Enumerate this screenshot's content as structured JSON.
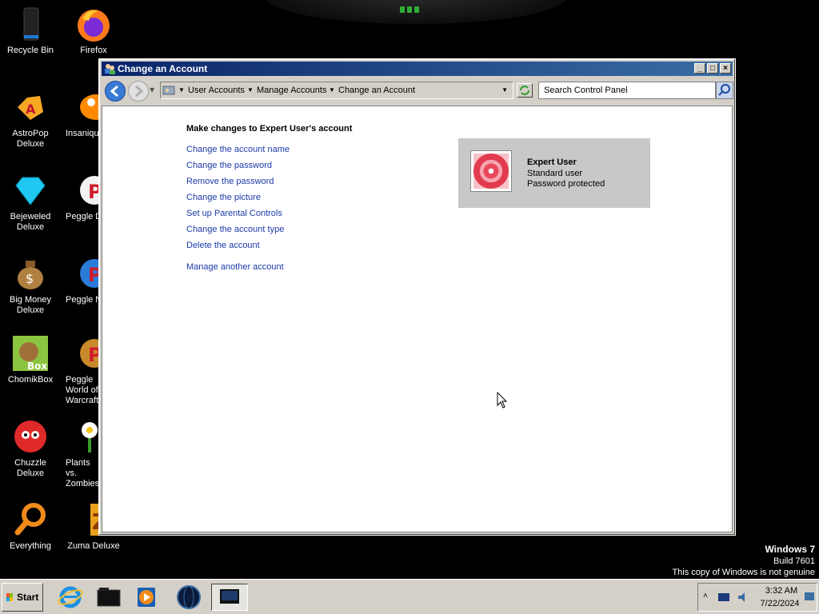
{
  "desktop": {
    "icons": [
      {
        "label": "Recycle Bin"
      },
      {
        "label": "Firefox"
      },
      {
        "label": "AstroPop Deluxe"
      },
      {
        "label": "Insaniquarium Deluxe"
      },
      {
        "label": "Bejeweled Deluxe"
      },
      {
        "label": "Peggle Deluxe"
      },
      {
        "label": "Big Money Deluxe"
      },
      {
        "label": "Peggle Nights Deluxe"
      },
      {
        "label": "ChomikBox"
      },
      {
        "label": "Peggle World of Warcraft"
      },
      {
        "label": "Chuzzle Deluxe"
      },
      {
        "label": "Plants vs. Zombies"
      },
      {
        "label": "Everything"
      },
      {
        "label": "Zuma Deluxe"
      }
    ]
  },
  "window": {
    "title": "Change an Account",
    "breadcrumbs": [
      "User Accounts",
      "Manage Accounts",
      "Change an Account"
    ],
    "search_placeholder": "Search Control Panel",
    "heading": "Make changes to Expert User's account",
    "tasks": [
      "Change the account name",
      "Change the password",
      "Remove the password",
      "Change the picture",
      "Set up Parental Controls",
      "Change the account type",
      "Delete the account"
    ],
    "other_task": "Manage another account",
    "account": {
      "name": "Expert User",
      "type": "Standard user",
      "status": "Password protected"
    }
  },
  "watermark": {
    "line1": "Windows 7",
    "line2": "Build 7601",
    "line3": "This copy of Windows is not genuine"
  },
  "taskbar": {
    "start_label": "Start",
    "time": "3:32 AM",
    "date": "7/22/2024"
  },
  "colors": {
    "titlebar_start": "#0a246a",
    "titlebar_end": "#3a6ea5",
    "link": "#1c3aa9",
    "desktop": "#000000"
  }
}
